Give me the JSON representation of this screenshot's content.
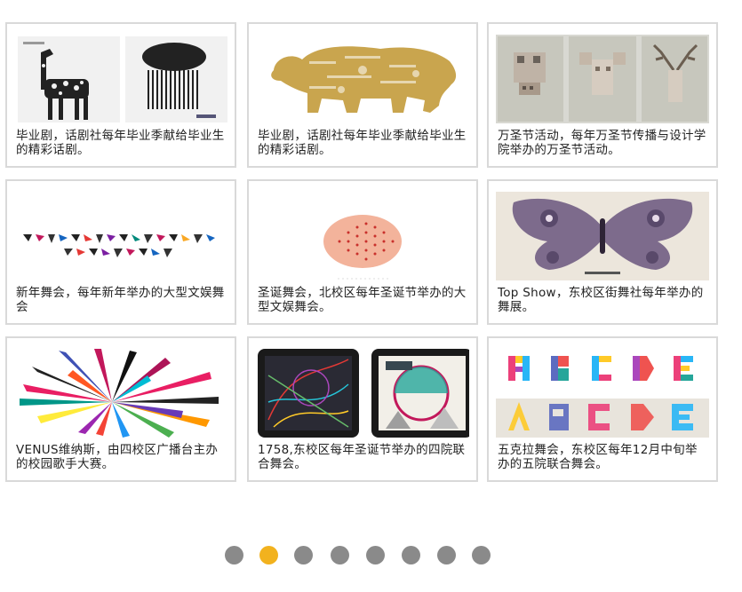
{
  "gallery": {
    "items": [
      {
        "caption": "毕业剧，话剧社每年毕业季献给毕业生的精彩话剧。",
        "image": "giraffe-and-mushroom-cloud-posters"
      },
      {
        "caption": "毕业剧，话剧社每年毕业季献给毕业生的精彩话剧。",
        "image": "typographic-gold-bear"
      },
      {
        "caption": "万圣节活动，每年万圣节传播与设计学院举办的万圣节活动。",
        "image": "pixel-skull-posters"
      },
      {
        "caption": "新年舞会，每年新年举办的大型文娱舞会",
        "image": "geometric-alphabet"
      },
      {
        "caption": "圣诞舞会，北校区每年圣诞节举办的大型文娱舞会。",
        "image": "dotted-oval"
      },
      {
        "caption": "Top Show，东校区街舞社每年举办的舞展。",
        "image": "watercolor-butterfly-poster"
      },
      {
        "caption": "VENUS维纳斯，由四校区广播台主办的校园歌手大赛。",
        "image": "exploding-color-strips"
      },
      {
        "caption": "1758,东校区每年圣诞节举办的四院联合舞会。",
        "image": "tablet-artworks"
      },
      {
        "caption": "五克拉舞会，东校区每年12月中旬举办的五院联合舞会。",
        "image": "colorful-abcde-letters"
      }
    ]
  },
  "pagination": {
    "total": 8,
    "active_index": 1,
    "active_color": "#f2b21e",
    "inactive_color": "#8a8a8a"
  }
}
